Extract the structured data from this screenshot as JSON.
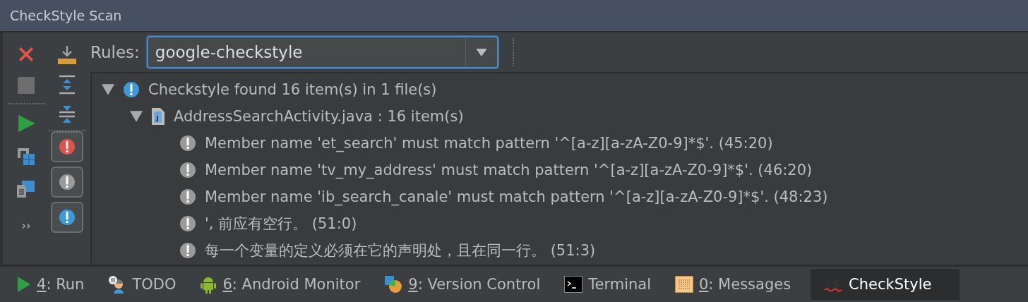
{
  "window": {
    "title": "CheckStyle Scan"
  },
  "toolbar": {
    "rules_label": "Rules:",
    "rules_value": "google-checkstyle",
    "filters": [
      {
        "kind": "error",
        "selected": true
      },
      {
        "kind": "warning",
        "selected": true
      },
      {
        "kind": "info",
        "selected": true
      }
    ],
    "more": "››"
  },
  "tree": [
    {
      "kind": "info",
      "text": "Checkstyle found 16 item(s) in 1 file(s)",
      "expanded": true,
      "children": [
        {
          "kind": "file",
          "text": "AddressSearchActivity.java : 16 item(s)",
          "expanded": true,
          "children": [
            {
              "kind": "warning",
              "text": "Member name 'et_search' must match pattern '^[a-z][a-zA-Z0-9]*$'. (45:20)"
            },
            {
              "kind": "warning",
              "text": "Member name 'tv_my_address' must match pattern '^[a-z][a-zA-Z0-9]*$'. (46:20)"
            },
            {
              "kind": "warning",
              "text": "Member name 'ib_search_canale' must match pattern '^[a-z][a-zA-Z0-9]*$'. (48:23)"
            },
            {
              "kind": "warning",
              "text": "', 前应有空行。 (51:0)"
            },
            {
              "kind": "warning",
              "text": "每一个变量的定义必须在它的声明处，且在同一行。 (51:3)"
            }
          ]
        }
      ]
    }
  ],
  "bottom_tabs": [
    {
      "kind": "run",
      "label": "4: Run",
      "mnemonic": true,
      "selected": false
    },
    {
      "kind": "todo",
      "label": "TODO",
      "mnemonic": false,
      "selected": false
    },
    {
      "kind": "android",
      "label": "6: Android Monitor",
      "mnemonic": true,
      "selected": false
    },
    {
      "kind": "vcs",
      "label": "9: Version Control",
      "mnemonic": true,
      "selected": false
    },
    {
      "kind": "terminal",
      "label": "Terminal",
      "mnemonic": false,
      "selected": false
    },
    {
      "kind": "messages",
      "label": "0: Messages",
      "mnemonic": true,
      "selected": false
    },
    {
      "kind": "checkstyle",
      "label": "CheckStyle",
      "mnemonic": false,
      "selected": true
    }
  ]
}
